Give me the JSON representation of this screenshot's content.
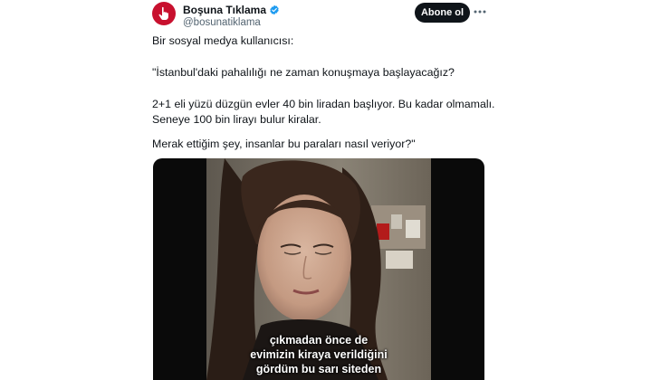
{
  "author": {
    "name": "Boşuna Tıklama",
    "handle": "@bosunatiklama",
    "brand_color": "#c8102e",
    "verified_color": "#1d9bf0",
    "avatar_icon": "pointing-hand-icon"
  },
  "actions": {
    "follow_label": "Abone ol",
    "more_icon": "more-dots-icon"
  },
  "tweet": {
    "lines": [
      "Bir sosyal medya kullanıcısı:",
      "\"İstanbul'daki pahalılığı ne zaman konuşmaya başlayacağız?",
      "2+1 eli yüzü düzgün evler 40 bin liradan başlıyor. Bu kadar olmamalı.",
      "Seneye 100 bin lirayı bulur kiralar.",
      "Merak ettiğim şey, insanlar bu paraları nasıl veriyor?\""
    ]
  },
  "video": {
    "subtitles": [
      "çıkmadan önce de",
      "evimizin kiraya verildiğini",
      "gördüm bu sarı siteden"
    ]
  }
}
